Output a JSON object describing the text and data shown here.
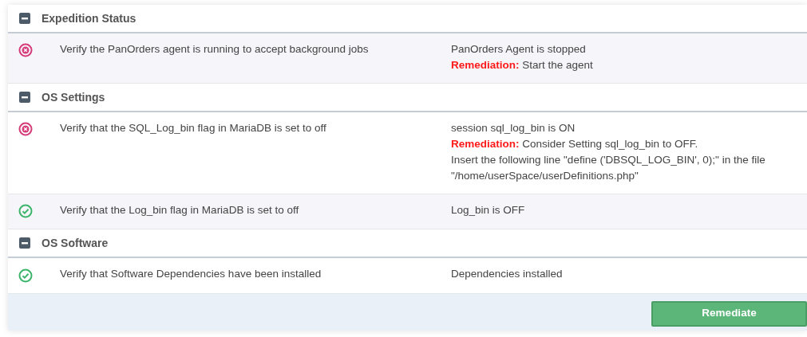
{
  "groups": [
    {
      "title": "Expedition Status",
      "expanded": true,
      "checks": [
        {
          "passed": false,
          "description": "Verify the PanOrders agent is running to accept background jobs",
          "result": "PanOrders Agent is stopped",
          "remediation_label": "Remediation:",
          "remediation": [
            "Start the agent"
          ]
        }
      ]
    },
    {
      "title": "OS Settings",
      "expanded": true,
      "checks": [
        {
          "passed": false,
          "description": "Verify that the SQL_Log_bin flag in MariaDB is set to off",
          "result": "session sql_log_bin is ON",
          "remediation_label": "Remediation:",
          "remediation": [
            "Consider Setting sql_log_bin to OFF.",
            "Insert the following line \"define ('DBSQL_LOG_BIN', 0);\" in the file \"/home/userSpace/userDefinitions.php\""
          ]
        },
        {
          "passed": true,
          "description": "Verify that the Log_bin flag in MariaDB is set to off",
          "result": "Log_bin is OFF"
        }
      ]
    },
    {
      "title": "OS Software",
      "expanded": true,
      "checks": [
        {
          "passed": true,
          "description": "Verify that Software Dependencies have been installed",
          "result": "Dependencies installed"
        }
      ]
    }
  ],
  "footer": {
    "button": "Remediate"
  }
}
